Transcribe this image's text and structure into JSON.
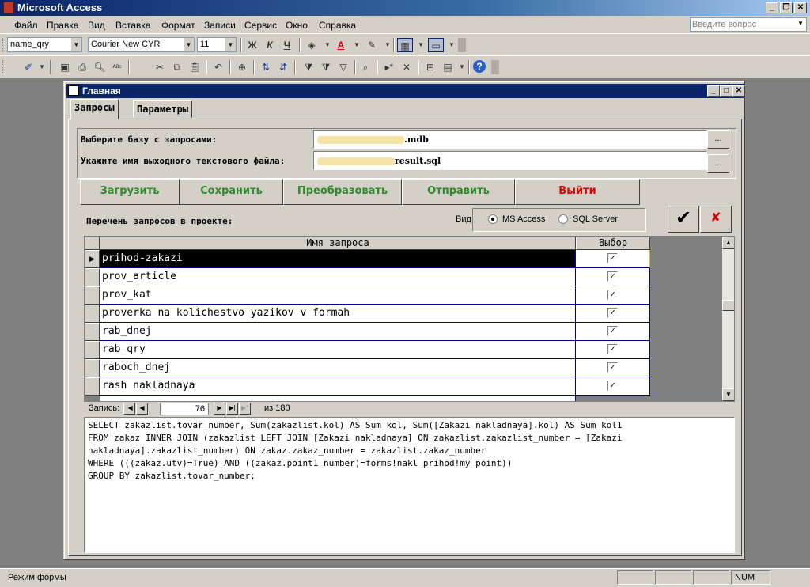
{
  "app": {
    "title": "Microsoft Access"
  },
  "menu": [
    "Файл",
    "Правка",
    "Вид",
    "Вставка",
    "Формат",
    "Записи",
    "Сервис",
    "Окно",
    "Справка"
  ],
  "help": {
    "placeholder": "Введите вопрос"
  },
  "format_toolbar": {
    "object": "name_qry",
    "font": "Courier New CYR",
    "size": "11",
    "bold": "Ж",
    "italic": "К",
    "underline": "Ч"
  },
  "form": {
    "title": "Главная",
    "tabs": [
      "Запросы",
      "Параметры"
    ],
    "db_label": "Выберите базу с запросами:",
    "db_value_suffix": ".mdb",
    "out_label": "Укажите имя выходного текстового файла:",
    "out_value_suffix": "result.sql",
    "browse_label": "...",
    "buttons": {
      "load": "Загрузить",
      "save": "Сохранить",
      "convert": "Преобразовать",
      "send": "Отправить",
      "exit": "Выйти"
    },
    "list_label": "Перечень запросов в проекте:",
    "view_label": "Вид",
    "radio_access": "MS Access",
    "radio_sql": "SQL Server",
    "grid": {
      "col_name": "Имя запроса",
      "col_select": "Выбор",
      "rows": [
        "prihod-zakazi",
        "prov_article",
        "prov_kat",
        "proverka na kolichestvo yazikov v formah",
        "rab_dnej",
        "rab_qry",
        "raboch_dnej",
        "rash nakladnaya"
      ]
    },
    "nav": {
      "label": "Запись:",
      "current": "76",
      "total": "из 180"
    },
    "sql": "SELECT zakazlist.tovar_number, Sum(zakazlist.kol) AS Sum_kol, Sum([Zakazi nakladnaya].kol) AS Sum_kol1\nFROM zakaz INNER JOIN (zakazlist LEFT JOIN [Zakazi nakladnaya] ON zakazlist.zakazlist_number = [Zakazi nakladnaya].zakazlist_number) ON zakaz.zakaz_number = zakazlist.zakaz_number\nWHERE (((zakaz.utv)=True) AND ((zakaz.point1_number)=forms!nakl_prihod!my_point))\nGROUP BY zakazlist.tovar_number;"
  },
  "status": {
    "mode": "Режим формы",
    "num": "NUM"
  },
  "colors": {
    "load": "#2e8b2e",
    "exit": "#e00000",
    "accent_title": "#0a246a"
  }
}
